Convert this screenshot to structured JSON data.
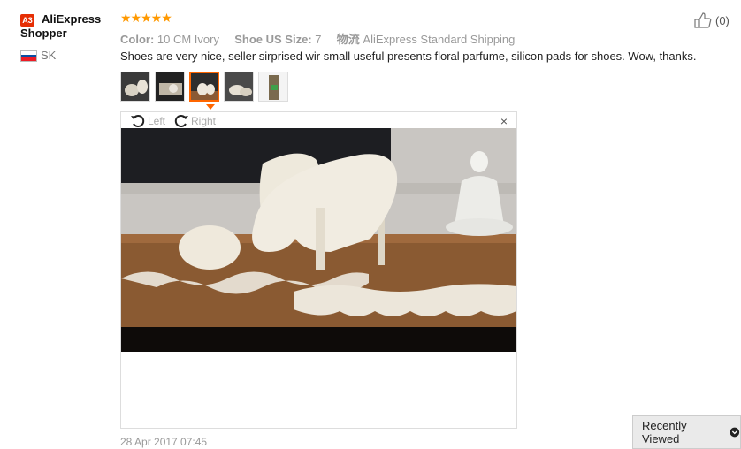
{
  "reviewer": {
    "badge": "A3",
    "name": "AliExpress Shopper",
    "country": "SK"
  },
  "rating": {
    "stars": "★★★★★",
    "value": 5
  },
  "meta": {
    "color_label": "Color:",
    "color_value": "10 CM Ivory",
    "size_label": "Shoe US Size:",
    "size_value": "7",
    "ship_label": "物流",
    "ship_value": "AliExpress Standard Shipping"
  },
  "review_text": "Shoes are very nice, seller sirprised wir small useful presents floral parfume, silicon pads for shoes. Wow, thanks.",
  "like": {
    "count": "(0)"
  },
  "viewer": {
    "left_label": "Left",
    "right_label": "Right",
    "close": "×"
  },
  "date": "28 Apr 2017 07:45",
  "recently_viewed": "Recently Viewed",
  "colors": {
    "badge": "#e62e04",
    "stars": "#ff9900",
    "accent": "#ff6600"
  }
}
